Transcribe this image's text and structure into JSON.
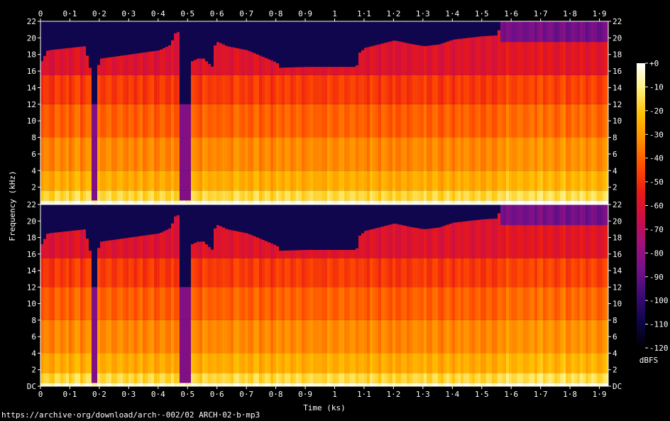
{
  "chart_data": {
    "type": "heatmap",
    "kind": "spectrogram",
    "channels": 2,
    "xlabel": "Time (ks)",
    "ylabel": "Frequency (kHz)",
    "x_ticks": [
      "0",
      "0·1",
      "0·2",
      "0·3",
      "0·4",
      "0·5",
      "0·6",
      "0·7",
      "0·8",
      "0·9",
      "1",
      "1·1",
      "1·2",
      "1·3",
      "1·4",
      "1·5",
      "1·6",
      "1·7",
      "1·8",
      "1·9"
    ],
    "x_tick_values": [
      0,
      0.1,
      0.2,
      0.3,
      0.4,
      0.5,
      0.6,
      0.7,
      0.8,
      0.9,
      1.0,
      1.1,
      1.2,
      1.3,
      1.4,
      1.5,
      1.6,
      1.7,
      1.8,
      1.9
    ],
    "xlim": [
      0,
      1.93
    ],
    "y_ticks_upper": [
      "2",
      "4",
      "6",
      "8",
      "10",
      "12",
      "14",
      "16",
      "18",
      "20",
      "22"
    ],
    "y_ticks_lower": [
      "DC",
      "2",
      "4",
      "6",
      "8",
      "10",
      "12",
      "14",
      "16",
      "18",
      "20",
      "22"
    ],
    "y_tick_values": [
      0,
      2,
      4,
      6,
      8,
      10,
      12,
      14,
      16,
      18,
      20,
      22
    ],
    "ylim": [
      0,
      22
    ],
    "colorbar": {
      "label": "dBFS",
      "ticks": [
        "+0",
        "-10",
        "-20",
        "-30",
        "-40",
        "-50",
        "-60",
        "-70",
        "-80",
        "-90",
        "-100",
        "-110",
        "-120"
      ],
      "tick_values": [
        0,
        -10,
        -20,
        -30,
        -40,
        -50,
        -60,
        -70,
        -80,
        -90,
        -100,
        -110,
        -120
      ],
      "range": [
        -120,
        0
      ],
      "colors": [
        "#000000",
        "#0b0648",
        "#3b0a76",
        "#73108a",
        "#a0107a",
        "#cc0e48",
        "#ea1a14",
        "#ff4d00",
        "#ff8c00",
        "#ffc000",
        "#fff07a",
        "#ffffff"
      ]
    },
    "cutoff_profile_khz": {
      "t": [
        0,
        0.02,
        0.15,
        0.16,
        0.19,
        0.2,
        0.3,
        0.4,
        0.44,
        0.45,
        0.47,
        0.49,
        0.5,
        0.53,
        0.55,
        0.58,
        0.59,
        0.6,
        0.63,
        0.7,
        0.8,
        0.81,
        0.9,
        1.0,
        1.07,
        1.08,
        1.1,
        1.2,
        1.25,
        1.3,
        1.35,
        1.4,
        1.5,
        1.55,
        1.56,
        1.6,
        1.66,
        1.67,
        1.7,
        1.8,
        1.9,
        1.93
      ],
      "f": [
        17.2,
        18.5,
        19.0,
        16.4,
        16.4,
        17.5,
        18.0,
        18.5,
        19.2,
        20.5,
        20.8,
        16.0,
        17.0,
        17.5,
        17.5,
        16.5,
        19.5,
        19.5,
        19.0,
        18.5,
        17.0,
        16.4,
        16.5,
        16.5,
        16.5,
        18.2,
        18.8,
        19.7,
        19.3,
        19.0,
        19.2,
        19.8,
        20.2,
        20.3,
        22,
        22,
        22,
        22,
        22,
        22,
        22,
        22
      ]
    },
    "quiet_segments_ks": [
      [
        0.165,
        0.19
      ],
      [
        0.47,
        0.51
      ]
    ]
  },
  "footer": "https://archive·org/download/arch·-002/02 ARCH·02·b·mp3"
}
